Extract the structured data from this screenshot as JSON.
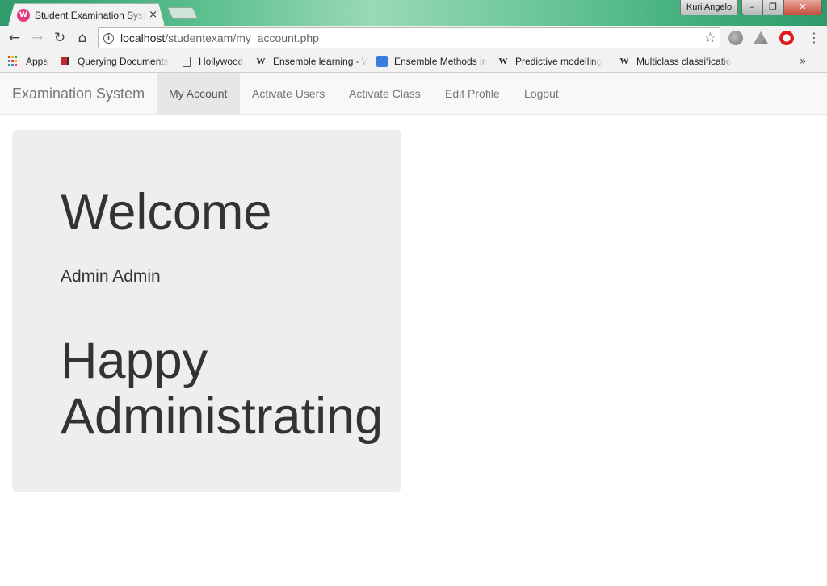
{
  "browser": {
    "tab": {
      "title": "Student Examination System",
      "favicon_text": "W"
    },
    "user": "Kuri Angelo",
    "window_buttons": {
      "minimize": "–",
      "restore": "❐",
      "close": "✕"
    },
    "nav": {
      "back": "←",
      "forward": "→",
      "reload": "↻",
      "home": "⌂"
    },
    "url": {
      "host": "localhost",
      "path": "/studentexam/my_account.php"
    },
    "bookmarks": [
      {
        "label": "Apps",
        "icon": "apps-grid-icon"
      },
      {
        "label": "Querying Documents",
        "icon": "document-red-icon"
      },
      {
        "label": "Hollywood",
        "icon": "page-icon"
      },
      {
        "label": "Ensemble learning - W",
        "icon": "wikipedia-icon"
      },
      {
        "label": "Ensemble Methods in",
        "icon": "blue-diamond-icon"
      },
      {
        "label": "Predictive modelling",
        "icon": "wikipedia-icon"
      },
      {
        "label": "Multiclass classification",
        "icon": "wikipedia-icon"
      }
    ],
    "more_bookmarks": "»"
  },
  "navbar": {
    "brand": "Examination System",
    "items": [
      {
        "label": "My Account",
        "active": true
      },
      {
        "label": "Activate Users",
        "active": false
      },
      {
        "label": "Activate Class",
        "active": false
      },
      {
        "label": "Edit Profile",
        "active": false
      },
      {
        "label": "Logout",
        "active": false
      }
    ]
  },
  "main": {
    "heading": "Welcome",
    "user_name": "Admin Admin",
    "message": "Happy Administrating"
  },
  "colors": {
    "navbar_bg": "#f8f8f8",
    "active_nav_bg": "#e7e7e7",
    "jumbotron_bg": "#eeeeee",
    "text": "#333333",
    "titlebar_accent": "#3fae7a"
  }
}
